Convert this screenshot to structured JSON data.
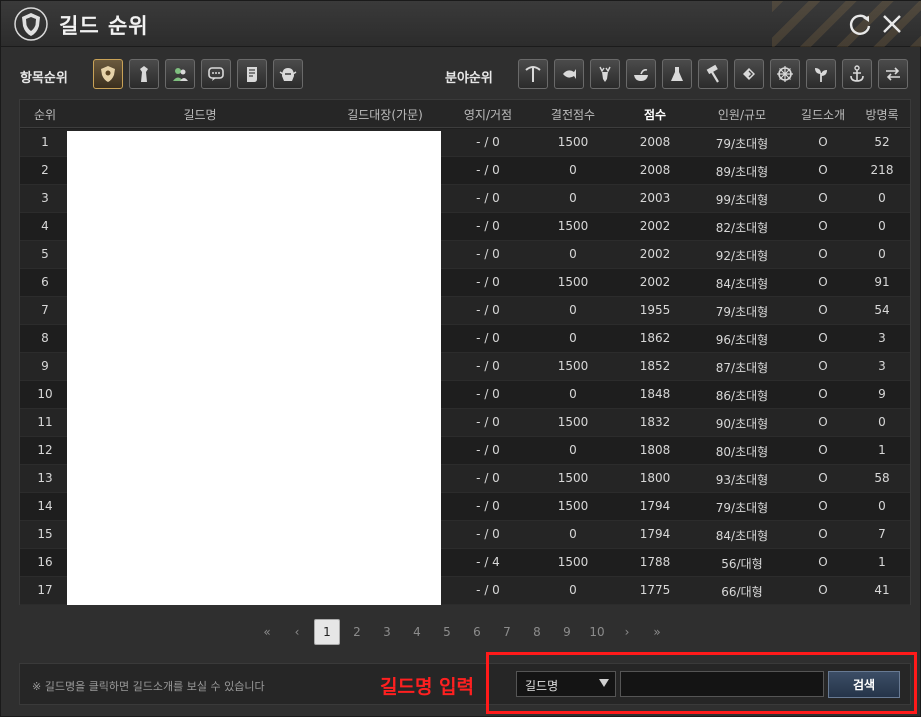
{
  "window": {
    "title": "길드 순위"
  },
  "filters": {
    "category_label": "항목순위",
    "field_label": "분야순위",
    "category_icons": [
      "guild-shield-icon",
      "tower-icon",
      "people-icon",
      "chat-icon",
      "scroll-icon",
      "helm-icon"
    ],
    "field_icons": [
      "pickaxe-icon",
      "fish-icon",
      "deer-icon",
      "cooking-icon",
      "alchemy-icon",
      "hammer-icon",
      "trade-icon",
      "wheel-icon",
      "sprout-icon",
      "anchor-icon",
      "exchange-icon"
    ]
  },
  "table": {
    "headers": {
      "rank": "순위",
      "guild_name": "길드명",
      "master": "길드대장(가문)",
      "territory": "영지/거점",
      "war_score": "결전점수",
      "score": "점수",
      "members": "인원/규모",
      "intro": "길드소개",
      "guestbook": "방명록"
    },
    "rows": [
      {
        "rank": "1",
        "territory": "- / 0",
        "war_score": "1500",
        "score": "2008",
        "members": "79/초대형",
        "intro": "O",
        "guestbook": "52"
      },
      {
        "rank": "2",
        "territory": "- / 0",
        "war_score": "0",
        "score": "2008",
        "members": "89/초대형",
        "intro": "O",
        "guestbook": "218"
      },
      {
        "rank": "3",
        "territory": "- / 0",
        "war_score": "0",
        "score": "2003",
        "members": "99/초대형",
        "intro": "O",
        "guestbook": "0"
      },
      {
        "rank": "4",
        "territory": "- / 0",
        "war_score": "1500",
        "score": "2002",
        "members": "82/초대형",
        "intro": "O",
        "guestbook": "0"
      },
      {
        "rank": "5",
        "territory": "- / 0",
        "war_score": "0",
        "score": "2002",
        "members": "92/초대형",
        "intro": "O",
        "guestbook": "0"
      },
      {
        "rank": "6",
        "territory": "- / 0",
        "war_score": "1500",
        "score": "2002",
        "members": "84/초대형",
        "intro": "O",
        "guestbook": "91"
      },
      {
        "rank": "7",
        "territory": "- / 0",
        "war_score": "0",
        "score": "1955",
        "members": "79/초대형",
        "intro": "O",
        "guestbook": "54"
      },
      {
        "rank": "8",
        "territory": "- / 0",
        "war_score": "0",
        "score": "1862",
        "members": "96/초대형",
        "intro": "O",
        "guestbook": "3"
      },
      {
        "rank": "9",
        "territory": "- / 0",
        "war_score": "1500",
        "score": "1852",
        "members": "87/초대형",
        "intro": "O",
        "guestbook": "3"
      },
      {
        "rank": "10",
        "territory": "- / 0",
        "war_score": "0",
        "score": "1848",
        "members": "86/초대형",
        "intro": "O",
        "guestbook": "9"
      },
      {
        "rank": "11",
        "territory": "- / 0",
        "war_score": "1500",
        "score": "1832",
        "members": "90/초대형",
        "intro": "O",
        "guestbook": "0"
      },
      {
        "rank": "12",
        "territory": "- / 0",
        "war_score": "0",
        "score": "1808",
        "members": "80/초대형",
        "intro": "O",
        "guestbook": "1"
      },
      {
        "rank": "13",
        "territory": "- / 0",
        "war_score": "1500",
        "score": "1800",
        "members": "93/초대형",
        "intro": "O",
        "guestbook": "58"
      },
      {
        "rank": "14",
        "territory": "- / 0",
        "war_score": "1500",
        "score": "1794",
        "members": "79/초대형",
        "intro": "O",
        "guestbook": "0"
      },
      {
        "rank": "15",
        "territory": "- / 0",
        "war_score": "0",
        "score": "1794",
        "members": "84/초대형",
        "intro": "O",
        "guestbook": "7"
      },
      {
        "rank": "16",
        "territory": "- / 4",
        "war_score": "1500",
        "score": "1788",
        "members": "56/대형",
        "intro": "O",
        "guestbook": "1"
      },
      {
        "rank": "17",
        "territory": "- / 0",
        "war_score": "0",
        "score": "1775",
        "members": "66/대형",
        "intro": "O",
        "guestbook": "41"
      }
    ]
  },
  "pagination": {
    "first": "«",
    "prev": "‹",
    "pages": [
      "1",
      "2",
      "3",
      "4",
      "5",
      "6",
      "7",
      "8",
      "9",
      "10"
    ],
    "current": "1",
    "next": "›",
    "last": "»"
  },
  "search": {
    "hint": "※ 길드명을 클릭하면 길드소개를 보실 수 있습니다",
    "annotation": "길드명 입력",
    "select_value": "길드명",
    "input_value": "",
    "button_label": "검색"
  },
  "colors": {
    "annotation_red": "#ff1a1a",
    "active_icon_border": "#c9a257",
    "search_button": "#2f405a"
  }
}
